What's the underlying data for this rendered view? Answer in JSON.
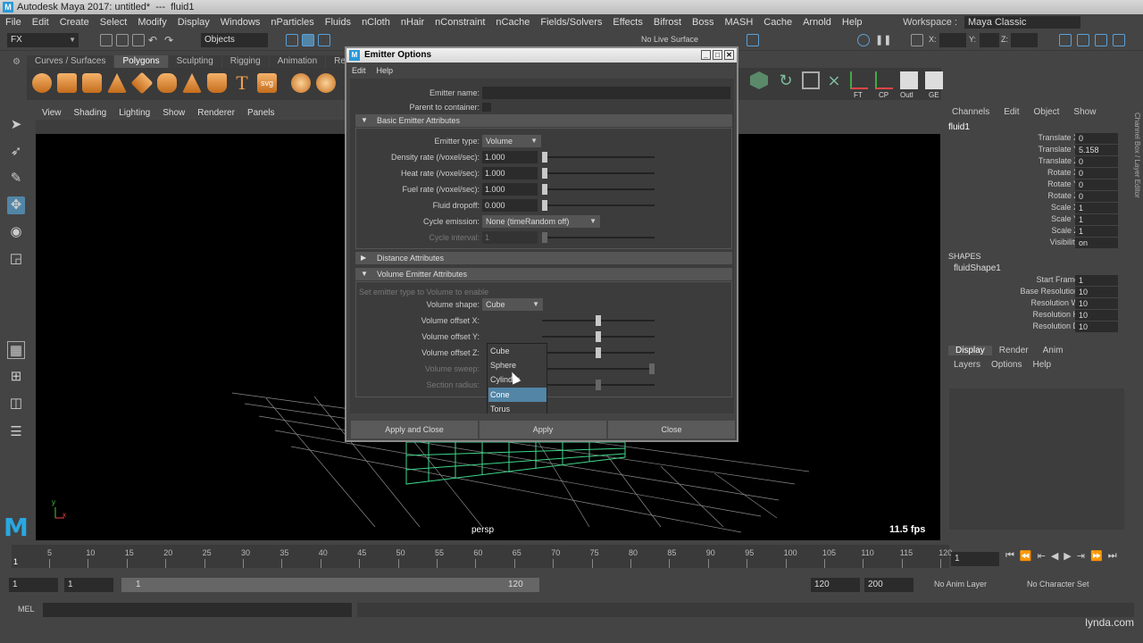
{
  "titlebar": {
    "app_title": "Autodesk Maya 2017: untitled*",
    "separator": "---",
    "object": "fluid1"
  },
  "menubar": [
    "File",
    "Edit",
    "Create",
    "Select",
    "Modify",
    "Display",
    "Windows",
    "nParticles",
    "Fluids",
    "nCloth",
    "nHair",
    "nConstraint",
    "nCache",
    "Fields/Solvers",
    "Effects",
    "Bifrost",
    "Boss",
    "MASH",
    "Cache",
    "Arnold",
    "Help"
  ],
  "workspace": {
    "label": "Workspace :",
    "value": "Maya Classic"
  },
  "statusline": {
    "menuset": "FX",
    "selection_mode": "Objects",
    "live_surface": "No Live Surface",
    "x_label": "X:",
    "y_label": "Y:",
    "z_label": "Z:"
  },
  "shelf": {
    "tabs": [
      "Curves / Surfaces",
      "Polygons",
      "Sculpting",
      "Rigging",
      "Animation",
      "Rende"
    ],
    "active_tab": "Polygons",
    "svg_label": "svg",
    "text_label": "T",
    "right_icons": [
      "FT",
      "CP",
      "Outl",
      "GE"
    ]
  },
  "panel": {
    "menu": [
      "View",
      "Shading",
      "Lighting",
      "Show",
      "Renderer",
      "Panels"
    ],
    "camera": "persp",
    "fps": "11.5 fps",
    "axis_y": "y",
    "axis_x": "x"
  },
  "channelbox": {
    "menu": [
      "Channels",
      "Edit",
      "Object",
      "Show"
    ],
    "object": "fluid1",
    "attrs": [
      {
        "label": "Translate X",
        "value": "0"
      },
      {
        "label": "Translate Y",
        "value": "5.158"
      },
      {
        "label": "Translate Z",
        "value": "0"
      },
      {
        "label": "Rotate X",
        "value": "0"
      },
      {
        "label": "Rotate Y",
        "value": "0"
      },
      {
        "label": "Rotate Z",
        "value": "0"
      },
      {
        "label": "Scale X",
        "value": "1"
      },
      {
        "label": "Scale Y",
        "value": "1"
      },
      {
        "label": "Scale Z",
        "value": "1"
      },
      {
        "label": "Visibility",
        "value": "on"
      }
    ],
    "shapes_header": "SHAPES",
    "shape_name": "fluidShape1",
    "shape_attrs": [
      {
        "label": "Start Frame",
        "value": "1"
      },
      {
        "label": "Base Resolution",
        "value": "10"
      },
      {
        "label": "Resolution W",
        "value": "10"
      },
      {
        "label": "Resolution H",
        "value": "10"
      },
      {
        "label": "Resolution D",
        "value": "10"
      }
    ],
    "side_tab": "Channel Box / Layer Editor"
  },
  "layers": {
    "tabs": [
      "Display",
      "Render",
      "Anim"
    ],
    "menu": [
      "Layers",
      "Options",
      "Help"
    ]
  },
  "timeline": {
    "ticks": [
      "5",
      "10",
      "15",
      "20",
      "25",
      "30",
      "35",
      "40",
      "45",
      "50",
      "55",
      "60",
      "65",
      "70",
      "75",
      "80",
      "85",
      "90",
      "95",
      "100",
      "105",
      "110",
      "115",
      "120"
    ],
    "start_tick": "1",
    "current_frame": "1"
  },
  "range": {
    "start": "1",
    "anim_start": "1",
    "range_start": "1",
    "range_end": "120",
    "anim_end": "120",
    "end": "200",
    "anim_layer": "No Anim Layer",
    "char_set": "No Character Set"
  },
  "cmdline": {
    "lang": "MEL"
  },
  "watermark": "lynda.com",
  "dialog": {
    "title": "Emitter Options",
    "menu": [
      "Edit",
      "Help"
    ],
    "emitter_name_label": "Emitter name:",
    "emitter_name_value": "",
    "parent_label": "Parent to container:",
    "basic_section": "Basic Emitter Attributes",
    "emitter_type_label": "Emitter type:",
    "emitter_type_value": "Volume",
    "density_label": "Density rate (/voxel/sec):",
    "density_value": "1.000",
    "heat_label": "Heat rate (/voxel/sec):",
    "heat_value": "1.000",
    "fuel_label": "Fuel rate (/voxel/sec):",
    "fuel_value": "1.000",
    "dropoff_label": "Fluid dropoff:",
    "dropoff_value": "0.000",
    "cycle_label": "Cycle emission:",
    "cycle_value": "None (timeRandom off)",
    "interval_label": "Cycle interval:",
    "interval_value": "1",
    "distance_section": "Distance Attributes",
    "volume_section": "Volume Emitter Attributes",
    "volume_hint": "Set emitter type to Volume to enable",
    "shape_label": "Volume shape:",
    "shape_value": "Cube",
    "offx_label": "Volume offset X:",
    "offy_label": "Volume offset Y:",
    "offz_label": "Volume offset Z:",
    "sweep_label": "Volume sweep:",
    "radius_label": "Section radius:",
    "shape_options": [
      "Cube",
      "Sphere",
      "Cylinder",
      "Cone",
      "Torus"
    ],
    "highlighted_option": "Cone",
    "buttons": {
      "apply_close": "Apply and Close",
      "apply": "Apply",
      "close": "Close"
    }
  }
}
